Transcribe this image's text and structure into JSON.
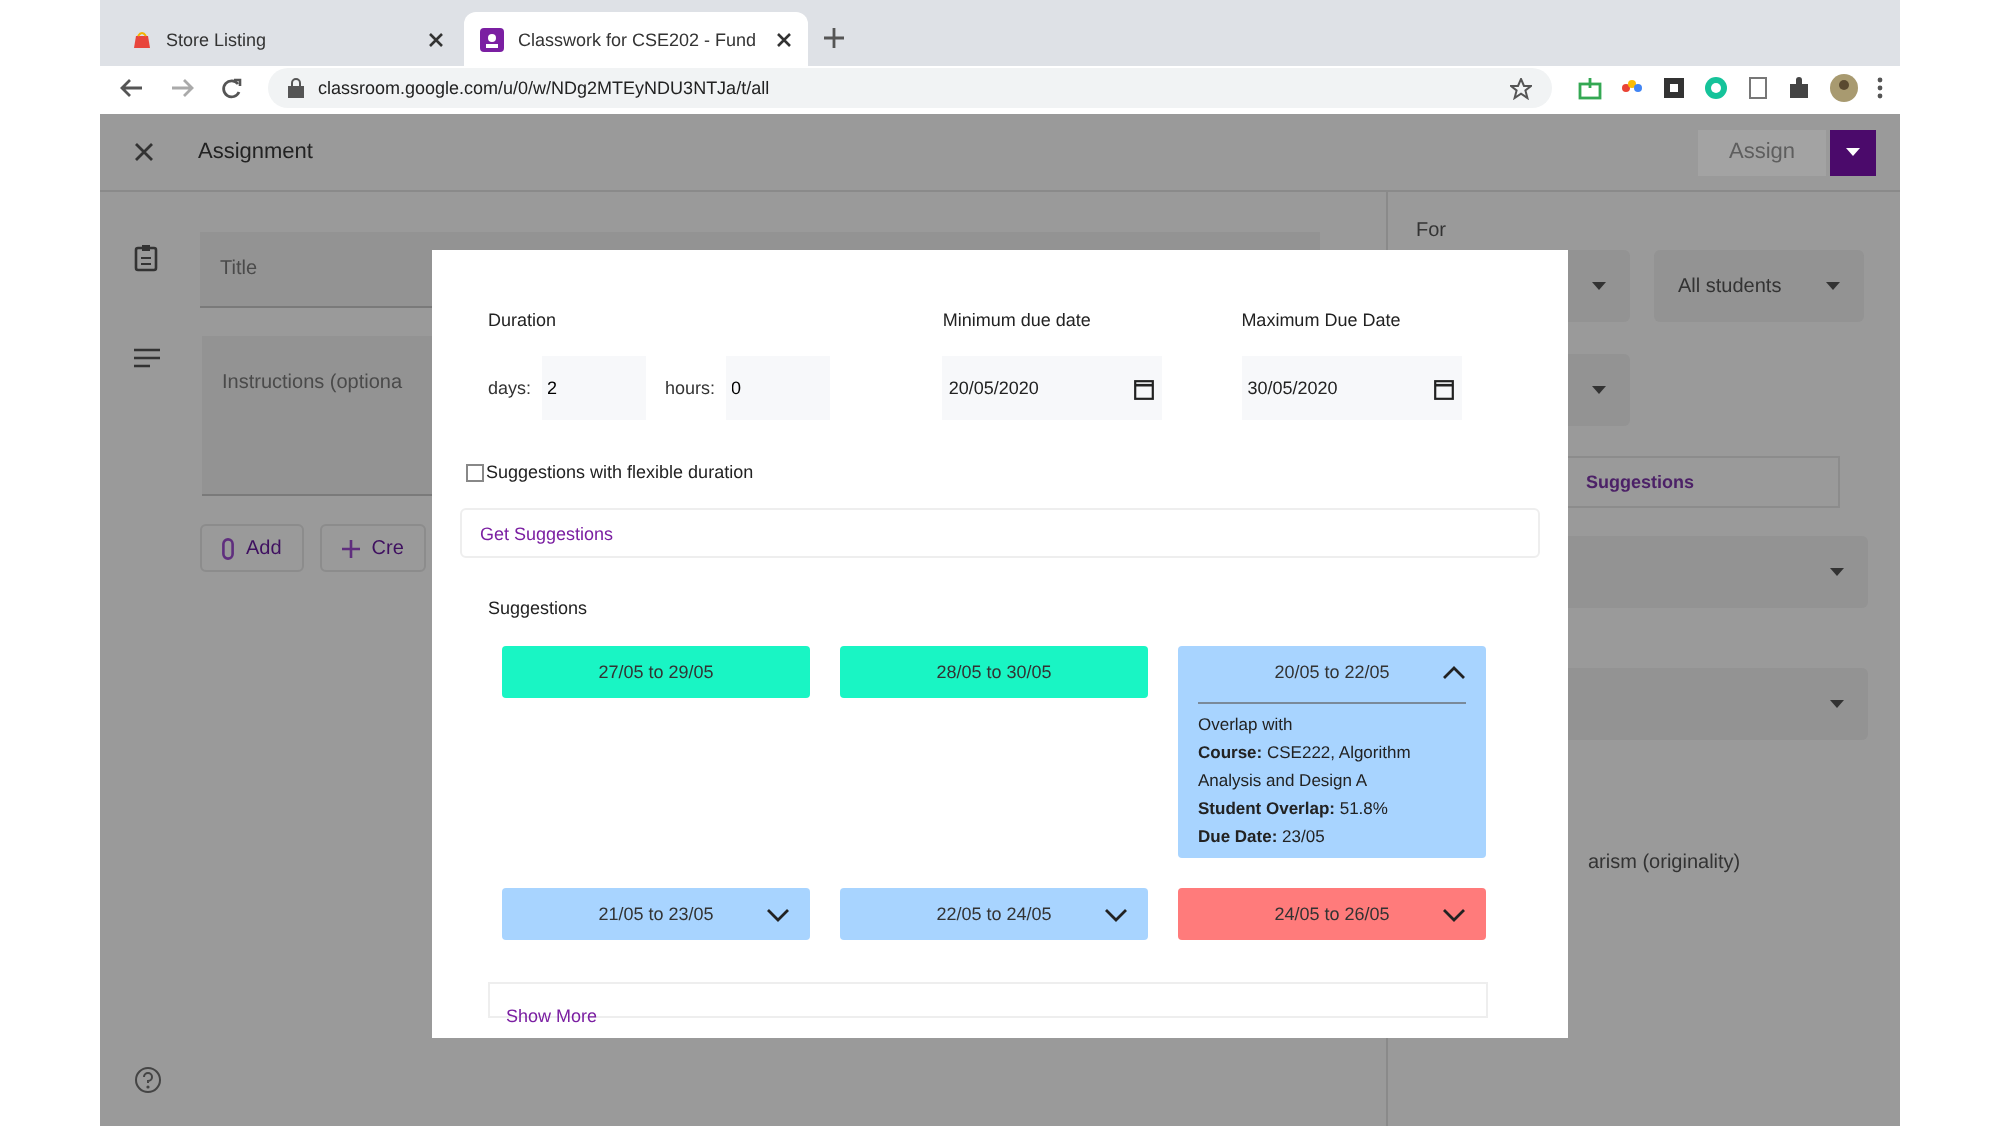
{
  "browser": {
    "tabs": [
      {
        "title": "Store Listing",
        "selected": false
      },
      {
        "title": "Classwork for CSE202 - Fund",
        "selected": true
      }
    ],
    "address": "classroom.google.com/u/0/w/NDg2MTEyNDU3NTJa/t/all"
  },
  "header": {
    "title": "Assignment",
    "assign": "Assign"
  },
  "form": {
    "title_placeholder": "Title",
    "instructions_placeholder": "Instructions (optiona",
    "buttons": [
      {
        "label": "Add"
      },
      {
        "label": "Cre"
      }
    ]
  },
  "side": {
    "for_label": "For",
    "students": "All students",
    "suggestions_link": "Suggestions",
    "plagiarism": "arism (originality)"
  },
  "dialog": {
    "duration_label": "Duration",
    "days_label": "days:",
    "days": "2",
    "hours_label": "hours:",
    "hours": "0",
    "min_label": "Minimum due date",
    "min_date": "20/05/2020",
    "max_label": "Maximum Due Date",
    "max_date": "30/05/2020",
    "flexible": {
      "label": "Suggestions with flexible duration",
      "checked": false
    },
    "get_button": "Get Suggestions",
    "suggestions_heading": "Suggestions",
    "suggestions": [
      {
        "range": "27/05 to 29/05",
        "color": "#19f5c4",
        "expandable": false
      },
      {
        "range": "28/05 to 30/05",
        "color": "#19f5c4",
        "expandable": false
      },
      {
        "range": "20/05 to 22/05",
        "color": "#a8d4ff",
        "expandable": true,
        "expanded": true,
        "details": [
          "Overlap with",
          "**Course:** CSE222, Algorithm Analysis and Design A",
          "**Student Overlap:** 51.8%",
          "**Due Date:** 23/05"
        ]
      },
      {
        "range": "21/05 to 23/05",
        "color": "#a8d4ff",
        "expandable": true,
        "expanded": false
      },
      {
        "range": "22/05 to 24/05",
        "color": "#a8d4ff",
        "expandable": true,
        "expanded": false
      },
      {
        "range": "24/05 to 26/05",
        "color": "#ff7b7b",
        "expandable": true,
        "expanded": false
      }
    ],
    "show_more": "Show More"
  }
}
